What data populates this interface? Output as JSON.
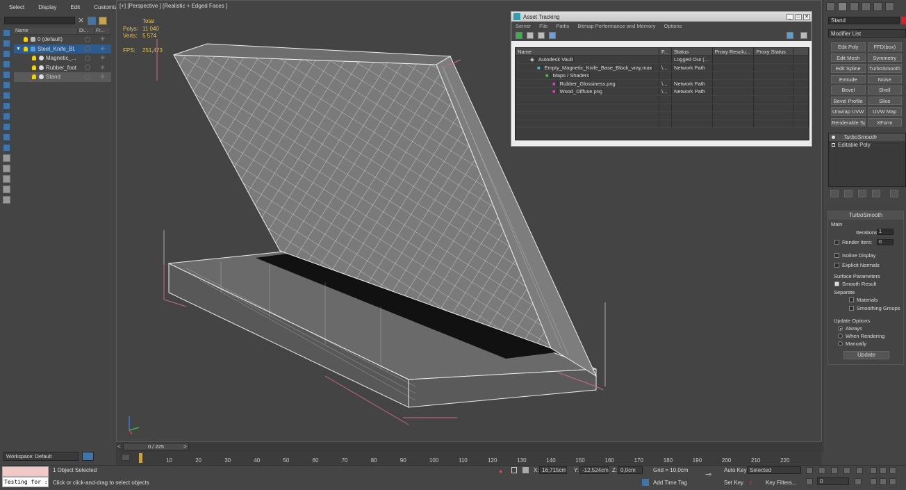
{
  "menu": [
    "Select",
    "Display",
    "Edit",
    "Customize"
  ],
  "scene": {
    "columns": [
      "Name",
      "Di...",
      "Fr..."
    ],
    "items": [
      {
        "label": "0 (default)",
        "type": "layer"
      },
      {
        "label": "Steel_Knife_Bl...",
        "type": "group",
        "selected": true
      },
      {
        "label": "Magnetic_...",
        "type": "object"
      },
      {
        "label": "Rubber_foot",
        "type": "object"
      },
      {
        "label": "Stand",
        "type": "object",
        "highlight": true
      }
    ]
  },
  "workspace": "Workspace: Default",
  "viewport": {
    "label": "[+] [Perspective ] [Realistic + Edged Faces ]",
    "stats": {
      "header": "Total",
      "polys_label": "Polys:",
      "polys": "11 040",
      "verts_label": "Verts:",
      "verts": "5 574",
      "fps_label": "FPS:",
      "fps": "251,473"
    }
  },
  "asset_tracking": {
    "title": "Asset Tracking",
    "menu": [
      "Server",
      "File",
      "Paths",
      "Bitmap Performance and Memory",
      "Options"
    ],
    "columns": [
      "Name",
      "F...",
      "Status",
      "Proxy Resolu...",
      "Proxy Status"
    ],
    "rows": [
      {
        "name": "Autodesk Vault",
        "f": "",
        "status": "Logged Out (...",
        "indent": 1
      },
      {
        "name": "Empty_Magnetic_Knife_Base_Block_vray.max",
        "f": "\\...",
        "status": "Network Path",
        "indent": 2
      },
      {
        "name": "Maps / Shaders",
        "f": "",
        "status": "",
        "indent": 3
      },
      {
        "name": "Rubber_Glossiness.png",
        "f": "\\...",
        "status": "Network Path",
        "indent": 4
      },
      {
        "name": "Wood_Diffuse.png",
        "f": "\\...",
        "status": "Network Path",
        "indent": 4
      }
    ]
  },
  "right_panel": {
    "object_name": "Stand",
    "modifier_list": "Modifier List",
    "buttons": [
      "Edit Poly",
      "FFD(box)",
      "Edit Mesh",
      "Symmetry",
      "Edit Spline",
      "TurboSmooth",
      "Extrude",
      "Noise",
      "Bevel",
      "Shell",
      "Bevel Profile",
      "Slice",
      "Unwrap UVW",
      "UVW Map",
      "Renderable Spline",
      "XForm"
    ],
    "stack": [
      "TurboSmooth",
      "Editable Poly"
    ],
    "turbosmooth": {
      "title": "TurboSmooth",
      "main": "Main",
      "iterations_label": "Iterations:",
      "iterations": "1",
      "render_iters_label": "Render Iters:",
      "render_iters": "0",
      "isoline": "Isoline Display",
      "explicit": "Explicit Normals",
      "surface": "Surface Parameters",
      "smooth_result": "Smooth Result",
      "separate": "Separate",
      "materials": "Materials",
      "smoothing_groups": "Smoothing Groups",
      "update_options": "Update Options",
      "always": "Always",
      "when_rendering": "When Rendering",
      "manually": "Manually",
      "update": "Update"
    }
  },
  "timeline": {
    "frame": "0 / 225",
    "ticks": [
      "10",
      "20",
      "30",
      "40",
      "50",
      "60",
      "70",
      "80",
      "90",
      "100",
      "110",
      "120",
      "130",
      "140",
      "150",
      "160",
      "170",
      "180",
      "190",
      "200",
      "210",
      "220"
    ]
  },
  "status": {
    "selected": "1 Object Selected",
    "prompt": "Click or click-and-drag to select objects",
    "script": "Testing for :",
    "x_label": "X:",
    "x": "16,715cm",
    "y_label": "Y:",
    "y": "-12,524cm",
    "z_label": "Z:",
    "z": "0,0cm",
    "grid": "Grid = 10,0cm",
    "add_time_tag": "Add Time Tag",
    "auto_key": "Auto Key",
    "set_key": "Set Key",
    "selected_dd": "Selected",
    "key_filters": "Key Filters...",
    "frame_field": "0"
  },
  "colors": {
    "accent": "#2b5b8f",
    "object_color": "#d4202b",
    "stats": "#e8c44a"
  }
}
